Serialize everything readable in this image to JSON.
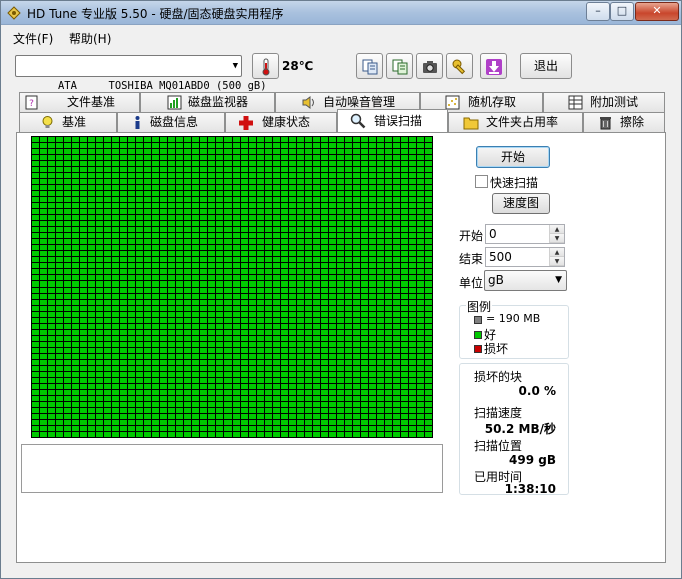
{
  "window": {
    "title": "HD Tune 专业版 5.50 - 硬盘/固态硬盘实用程序"
  },
  "title_buttons": {
    "minimize": "–",
    "maximize": "□",
    "close": "✕"
  },
  "menu": [
    {
      "label": "文件(F)"
    },
    {
      "label": "帮助(H)"
    }
  ],
  "toolbar": {
    "drive": "ATA     TOSHIBA MQ01ABD0 (500 gB)",
    "temperature": "28℃",
    "exit_label": "退出"
  },
  "tabs_row1": [
    {
      "label": "文件基准"
    },
    {
      "label": "磁盘监视器"
    },
    {
      "label": "自动噪音管理"
    },
    {
      "label": "随机存取"
    },
    {
      "label": "附加测试"
    }
  ],
  "tabs_row2": [
    {
      "label": "基准"
    },
    {
      "label": "磁盘信息"
    },
    {
      "label": "健康状态"
    },
    {
      "label": "错误扫描"
    },
    {
      "label": "文件夹占用率"
    },
    {
      "label": "擦除"
    }
  ],
  "scan": {
    "start_button": "开始",
    "quick_scan_label": "快速扫描",
    "quick_scan_checked": false,
    "speed_map_button": "速度图",
    "start_label": "开始",
    "start_value": "0",
    "end_label": "结束",
    "end_value": "500",
    "unit_label": "单位",
    "unit_value": "gB",
    "grid_columns": 50,
    "grid_rows": 50,
    "block_status": "good"
  },
  "legend": {
    "title": "图例",
    "block_size": "= 190 MB",
    "good": "好",
    "bad": "损坏",
    "colors": {
      "block": "#808080",
      "good": "#00c800",
      "bad": "#c80000"
    }
  },
  "stats": {
    "damaged_label": "损坏的块",
    "damaged_value": "0.0 %",
    "speed_label": "扫描速度",
    "speed_value": "50.2 MB/秒",
    "position_label": "扫描位置",
    "position_value": "499 gB",
    "elapsed_label": "已用时间",
    "elapsed_value": "1:38:10"
  },
  "colors": {
    "grid_good": "#00c800",
    "grid_lines": "#000000"
  }
}
